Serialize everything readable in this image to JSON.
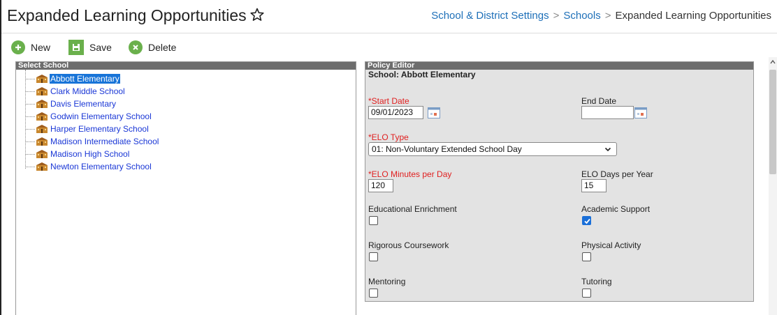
{
  "header": {
    "title": "Expanded Learning Opportunities",
    "breadcrumb": [
      "School & District Settings",
      "Schools",
      "Expanded Learning Opportunities"
    ]
  },
  "toolbar": {
    "new_label": "New",
    "save_label": "Save",
    "delete_label": "Delete"
  },
  "select_school": {
    "heading": "Select School",
    "items": [
      {
        "label": "Abbott Elementary",
        "selected": true
      },
      {
        "label": "Clark Middle School"
      },
      {
        "label": "Davis Elementary"
      },
      {
        "label": "Godwin Elementary School"
      },
      {
        "label": "Harper Elementary School"
      },
      {
        "label": "Madison Intermediate School"
      },
      {
        "label": "Madison High School"
      },
      {
        "label": "Newton Elementary School"
      }
    ]
  },
  "policy_editor": {
    "heading": "Policy Editor",
    "school": "School: Abbott Elementary",
    "start_date_label": "*Start Date",
    "start_date_value": "09/01/2023",
    "end_date_label": "End Date",
    "end_date_value": "",
    "elo_type_label": "*ELO Type",
    "elo_type_value": "01: Non-Voluntary Extended School Day",
    "elo_minutes_label": "*ELO Minutes per Day",
    "elo_minutes_value": "120",
    "elo_days_label": "ELO Days per Year",
    "elo_days_value": "15",
    "checkboxes": [
      {
        "label": "Educational Enrichment",
        "checked": false
      },
      {
        "label": "Academic Support",
        "checked": true
      },
      {
        "label": "Rigorous Coursework",
        "checked": false
      },
      {
        "label": "Physical Activity",
        "checked": false
      },
      {
        "label": "Mentoring",
        "checked": false
      },
      {
        "label": "Tutoring",
        "checked": false
      }
    ]
  },
  "colors": {
    "accent_green": "#6ab04c",
    "link_blue": "#1d6fb8",
    "required_red": "#e02020",
    "panel_header": "#6d6d6d",
    "selection": "#1874d8"
  }
}
